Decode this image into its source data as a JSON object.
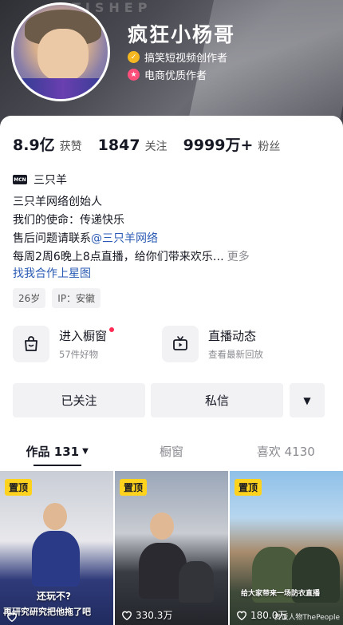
{
  "header": {
    "banner_text": "TISHEP",
    "nickname": "疯狂小杨哥",
    "badges": [
      {
        "label": "搞笑短视频创作者",
        "icon": "verified-gold-icon",
        "color": "#f5b820"
      },
      {
        "label": "电商优质作者",
        "icon": "merchant-star-icon",
        "color": "#ff4f7b"
      }
    ]
  },
  "stats": {
    "likes": {
      "value": "8.9亿",
      "label": "获赞"
    },
    "following": {
      "value": "1847",
      "label": "关注"
    },
    "followers": {
      "value": "9999万+",
      "label": "粉丝"
    }
  },
  "mcn": {
    "icon_label": "MCN",
    "name": "三只羊"
  },
  "bio": {
    "lines": [
      "三只羊网络创始人",
      "我们的使命：传递快乐"
    ],
    "contact_prefix": "售后问题请联系",
    "contact_link": "@三只羊网络",
    "schedule": "每周2周6晚上8点直播，给你们带来欢乐…",
    "more": "更多",
    "starmap_link": "找我合作上星图"
  },
  "tags": [
    "26岁",
    "IP：安徽"
  ],
  "entries": [
    {
      "title": "进入橱窗",
      "sub": "57件好物",
      "icon": "shopping-bag-icon"
    },
    {
      "title": "直播动态",
      "sub": "查看最新回放",
      "icon": "tv-icon"
    }
  ],
  "actions": {
    "follow": "已关注",
    "message": "私信",
    "more": "▼"
  },
  "tabs": [
    {
      "label": "作品 131",
      "caret": "▼"
    },
    {
      "label": "橱窗"
    },
    {
      "label": "喜欢 4130"
    }
  ],
  "videos": [
    {
      "pin": "置顶",
      "caption": "还玩不?",
      "caption2": "再研究研究把他拖了吧",
      "likes": "",
      "watermark": ""
    },
    {
      "pin": "置顶",
      "caption": "",
      "caption2": "",
      "likes": "330.3万",
      "watermark": ""
    },
    {
      "pin": "置顶",
      "caption": "给大家带来一场防衣直播",
      "caption2": "",
      "likes": "180.0万",
      "watermark": "贵饭人物ThePeople"
    }
  ],
  "colors": {
    "accent": "#fe2c55",
    "link": "#2a5ab3",
    "pin": "#ffd21e"
  }
}
